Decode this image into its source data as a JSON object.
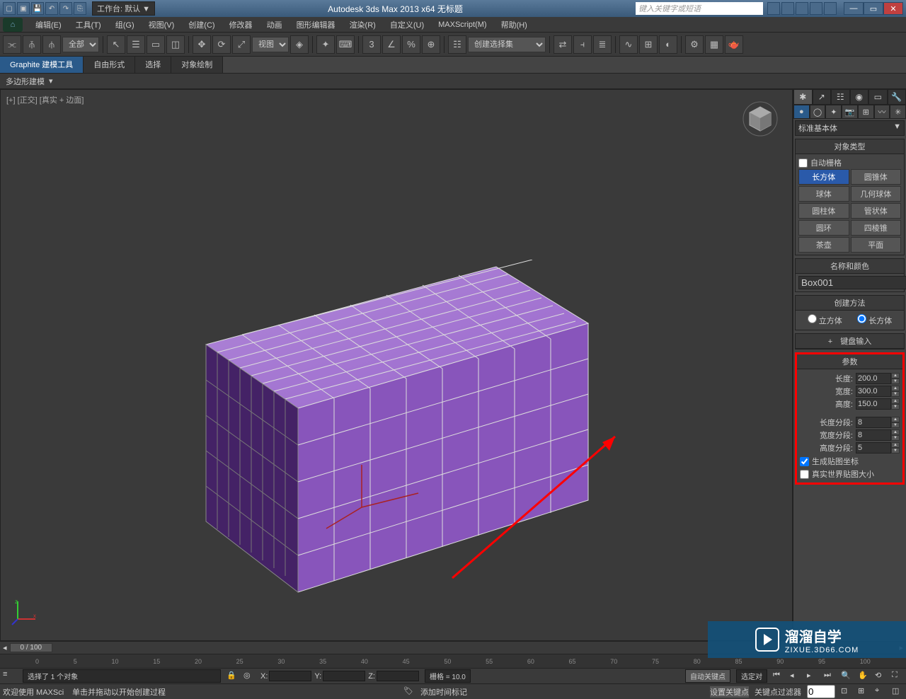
{
  "titlebar": {
    "workspace_label": "工作台: 默认",
    "app_title": "Autodesk 3ds Max  2013 x64   无标题",
    "search_placeholder": "键入关键字或短语"
  },
  "menubar": {
    "items": [
      "编辑(E)",
      "工具(T)",
      "组(G)",
      "视图(V)",
      "创建(C)",
      "修改器",
      "动画",
      "图形编辑器",
      "渲染(R)",
      "自定义(U)",
      "MAXScript(M)",
      "帮助(H)"
    ]
  },
  "toolbar": {
    "filter_label": "全部",
    "view_label": "视图",
    "selset_label": "创建选择集"
  },
  "ribbon": {
    "tabs": [
      "Graphite 建模工具",
      "自由形式",
      "选择",
      "对象绘制"
    ],
    "subtab": "多边形建模"
  },
  "viewport": {
    "label": "[+] [正交] [真实 + 边面]"
  },
  "cmdpanel": {
    "category_label": "标准基本体",
    "rollouts": {
      "object_type": {
        "title": "对象类型",
        "autogrid": "自动栅格",
        "buttons": [
          "长方体",
          "圆锥体",
          "球体",
          "几何球体",
          "圆柱体",
          "管状体",
          "圆环",
          "四棱锥",
          "茶壶",
          "平面"
        ]
      },
      "name_color": {
        "title": "名称和颜色",
        "name_value": "Box001"
      },
      "creation_method": {
        "title": "创建方法",
        "opt1": "立方体",
        "opt2": "长方体"
      },
      "keyboard_entry": {
        "title": "键盘输入"
      },
      "parameters": {
        "title": "参数",
        "length_label": "长度:",
        "length_value": "200.0",
        "width_label": "宽度:",
        "width_value": "300.0",
        "height_label": "高度:",
        "height_value": "150.0",
        "lsegs_label": "长度分段:",
        "lsegs_value": "8",
        "wsegs_label": "宽度分段:",
        "wsegs_value": "8",
        "hsegs_label": "高度分段:",
        "hsegs_value": "5",
        "gen_mapping": "生成贴图坐标",
        "real_world": "真实世界贴图大小"
      }
    }
  },
  "timeline": {
    "slider": "0 / 100",
    "ticks": [
      "0",
      "5",
      "10",
      "15",
      "20",
      "25",
      "30",
      "35",
      "40",
      "45",
      "50",
      "55",
      "60",
      "65",
      "70",
      "75",
      "80",
      "85",
      "90",
      "95",
      "100"
    ]
  },
  "status": {
    "selection": "选择了 1 个对象",
    "prompt": "单击并拖动以开始创建过程",
    "welcome": "欢迎使用  MAXSci",
    "x_label": "X:",
    "y_label": "Y:",
    "z_label": "Z:",
    "grid_label": "栅格 = 10.0",
    "add_time_tag": "添加时间标记",
    "auto_key": "自动关键点",
    "set_key": "设置关键点",
    "selected": "选定对",
    "key_filters": "关键点过滤器"
  },
  "watermark": {
    "big": "溜溜自学",
    "small": "ZIXUE.3D66.COM"
  }
}
